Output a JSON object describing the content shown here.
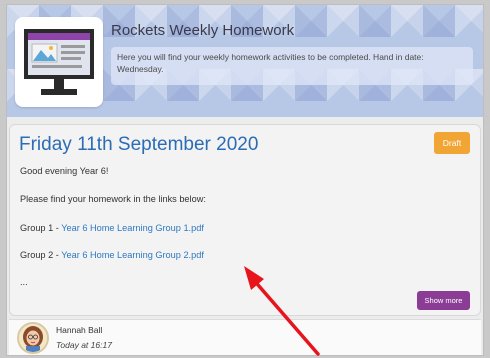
{
  "header": {
    "title": "Rockets Weekly Homework",
    "description": "Here you will find your weekly homework activities to be completed. Hand in date: Wednesday.",
    "logo_icon": "presentation-screen-icon"
  },
  "post": {
    "title": "Friday 11th September 2020",
    "badge": "Draft",
    "greeting": "Good evening Year 6!",
    "intro": "Please find your homework in the links below:",
    "links": [
      {
        "prefix": "Group 1 - ",
        "label": "Year 6 Home Learning Group 1.pdf"
      },
      {
        "prefix": "Group 2 - ",
        "label": "Year 6 Home Learning Group 2.pdf"
      }
    ],
    "ellipsis": "...",
    "show_more_label": "Show more"
  },
  "footer": {
    "author": "Hannah Ball",
    "timestamp": "Today at 16:17"
  },
  "colors": {
    "title_blue": "#2b6cb5",
    "link_blue": "#2e78c2",
    "draft_orange": "#f1a534",
    "show_more_purple": "#8b3d96",
    "annotation_red": "#e8141c"
  }
}
